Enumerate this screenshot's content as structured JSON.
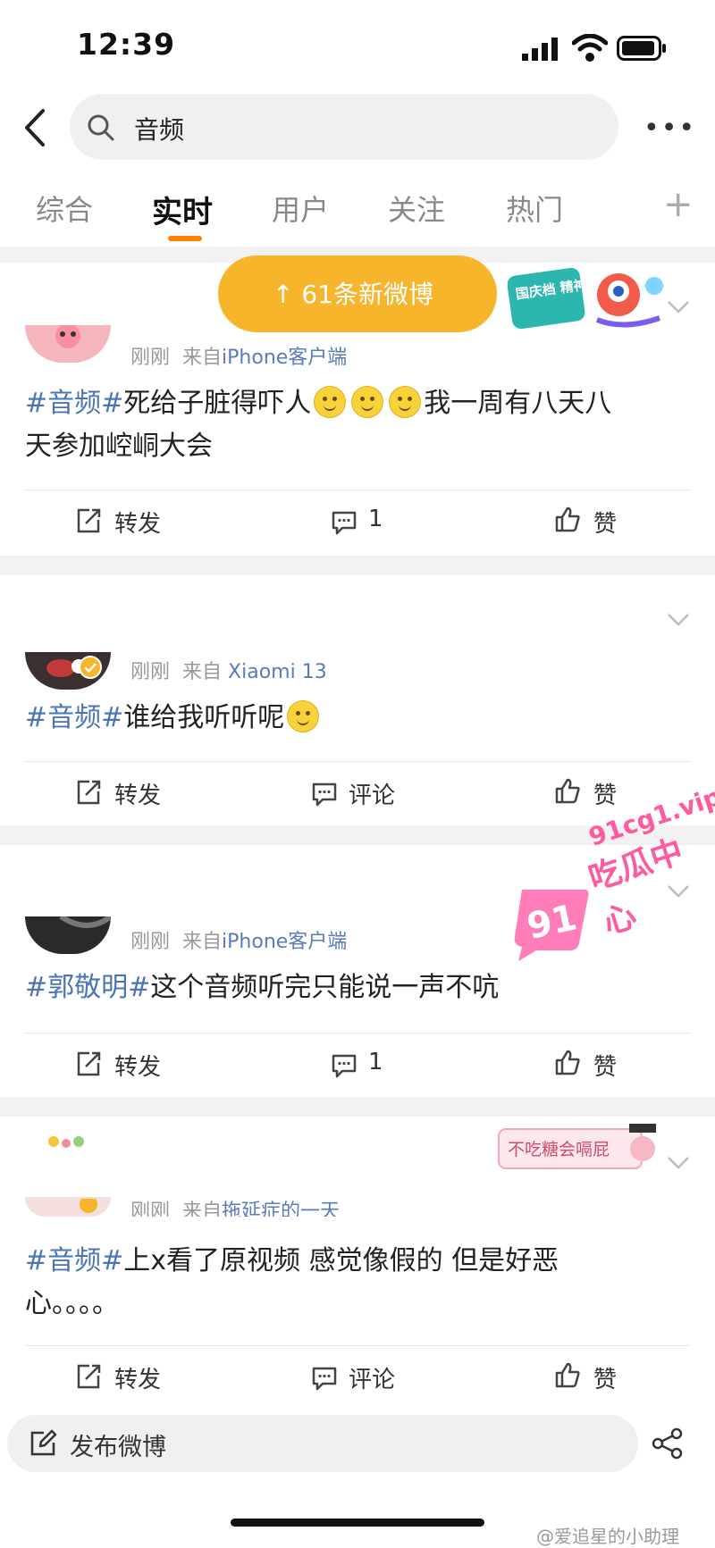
{
  "status_bar": {
    "time": "12:39"
  },
  "search": {
    "query": "音频"
  },
  "tabs": [
    "综合",
    "实时",
    "用户",
    "关注",
    "热门"
  ],
  "active_tab": "实时",
  "new_posts_banner": "↑ 61条新微博",
  "promo_badge_text": "国庆档 精神股东",
  "colors": {
    "accent": "#ff8200",
    "hashtag": "#4a74b5",
    "banner": "#f6b52a"
  },
  "posts": [
    {
      "time": "刚刚",
      "source_prefix": "来自",
      "source": "iPhone客户端",
      "hashtag": "#音频#",
      "text_line1": "死给子脏得吓人",
      "text_line1_tail": "我一周有八天八",
      "text_line2": "天参加崆峒大会",
      "repost": "转发",
      "comment": "1",
      "like": "赞"
    },
    {
      "time": "刚刚",
      "source_prefix": "来自",
      "source": "Xiaomi 13",
      "hashtag": "#音频#",
      "text": "谁给我听听呢",
      "repost": "转发",
      "comment": "评论",
      "like": "赞"
    },
    {
      "time": "刚刚",
      "source_prefix": "来自",
      "source": "iPhone客户端",
      "hashtag": "#郭敬明#",
      "text": "这个音频听完只能说一声不吭",
      "repost": "转发",
      "comment": "1",
      "like": "赞"
    },
    {
      "time": "刚刚",
      "source_prefix": "来自",
      "source": "拖延症的一天",
      "hashtag": "#音频#",
      "text_line1": "上x看了原视频 感觉像假的 但是好恶",
      "text_line2": "心。。。。",
      "sticker_text": "不吃糖会嗝屁",
      "repost": "转发",
      "comment": "评论",
      "like": "赞"
    }
  ],
  "composer": {
    "placeholder": "发布微博"
  },
  "watermark": {
    "url": "91cg1.vip",
    "name": "吃瓜中心",
    "badge": "91"
  },
  "credit": "@爱追星的小助理"
}
